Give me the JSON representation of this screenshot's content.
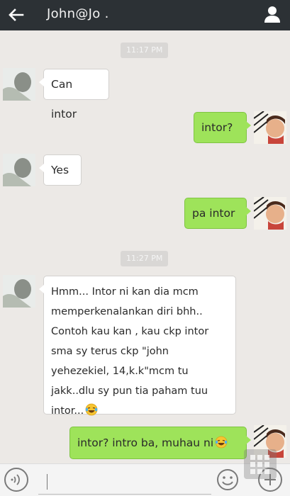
{
  "header": {
    "title": "John@Jo ."
  },
  "timestamps": [
    "11:17 PM",
    "11:27 PM"
  ],
  "messages": [
    {
      "direction": "in",
      "text": "Can intor"
    },
    {
      "direction": "out",
      "text": "intor?"
    },
    {
      "direction": "in",
      "text": "Yes"
    },
    {
      "direction": "out",
      "text": "pa intor"
    },
    {
      "direction": "in",
      "lines": [
        "Hmm... Intor ni kan dia mcm",
        "memperkenalankan diri bhh..",
        "Contoh kau kan , kau ckp intor",
        "sma sy terus ckp \"john",
        "yehezekiel, 14,k.k\"mcm tu",
        "jakk..dlu sy pun tia paham tuu",
        "intor..."
      ],
      "emoji": "laughing-tears-emoji"
    },
    {
      "direction": "out",
      "text": "intor? intro ba, muhau ni",
      "emoji": "laughing-tears-emoji"
    }
  ],
  "input": {
    "placeholder": ""
  },
  "colors": {
    "topbar": "#2c3135",
    "outgoing": "#9ee35a",
    "incoming": "#ffffff",
    "background": "#ece9e6"
  }
}
